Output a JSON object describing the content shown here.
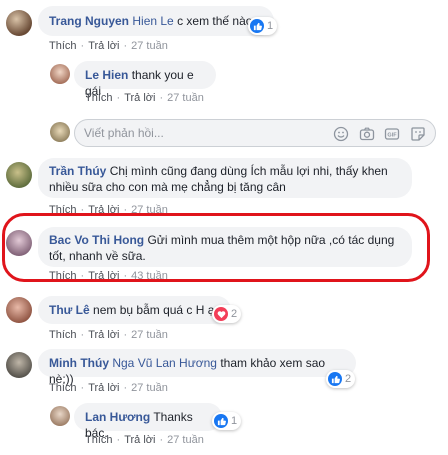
{
  "actions": {
    "like": "Thích",
    "reply": "Trả lời",
    "sep": "·"
  },
  "comments": [
    {
      "author": "Trang Nguyen",
      "tag": "Hien Le",
      "text": " c xem thế nào",
      "time": "27 tuần",
      "reaction_count": "1",
      "reaction": "like"
    },
    {
      "author": "Le Hien",
      "text": "thank you e gái",
      "time": "27 tuần"
    },
    {
      "author": "Trần Thúy",
      "text": "Chị mình cũng đang dùng Ích mẫu lợi nhi, thấy khen nhiều sữa cho con mà mẹ chẳng bị tăng cân",
      "time": "27 tuần"
    },
    {
      "author": "Bac Vo Thi Hong",
      "text": "Gửi mình mua thêm một hộp nữa ,có tác dụng tốt, nhanh về sữa.",
      "time": "43 tuần"
    },
    {
      "author": "Thư Lê",
      "text": "nem bụ bẫm quá c H ạ",
      "time": "27 tuần",
      "reaction_count": "2",
      "reaction": "love"
    },
    {
      "author": "Minh Thúy",
      "tag": "Nga Vũ Lan Hương",
      "text": " tham khảo xem sao nè:))",
      "time": "27 tuần",
      "reaction_count": "2",
      "reaction": "like"
    },
    {
      "author": "Lan Hương",
      "text": "Thanks bác.",
      "time": "27 tuần",
      "reaction_count": "1",
      "reaction": "like"
    }
  ],
  "reply_box": {
    "placeholder": "Viết phản hồi..."
  },
  "icons": [
    "emoji-icon",
    "camera-icon",
    "gif-icon",
    "sticker-icon"
  ],
  "colors": {
    "name": "#385898",
    "bubble": "#f2f3f5",
    "highlight": "#e0141b",
    "like": "#1877f2",
    "love": "#f33e58"
  }
}
